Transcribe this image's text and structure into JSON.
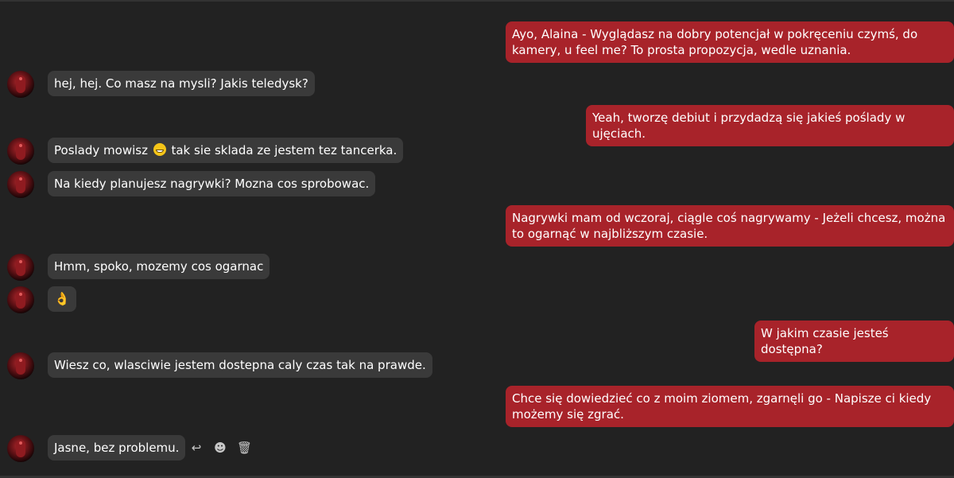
{
  "messages": {
    "m1": "Ayo, Alaina - Wyglądasz na dobry potencjał w pokręceniu czymś, do kamery, u feel me? To prosta propozycja, wedle uznania.",
    "m2": "hej, hej. Co masz na mysli? Jakis teledysk?",
    "m3": "Yeah, tworzę debiut i przydadzą się jakieś poślady w ujęciach.",
    "m4a": "Poslady mowisz ",
    "m4b": " tak sie sklada ze jestem tez tancerka.",
    "m5": "Na kiedy planujesz nagrywki? Mozna cos sprobowac.",
    "m6": "Nagrywki mam od wczoraj, ciągle coś nagrywamy - Jeżeli chcesz, można to ogarnąć w najbliższym czasie.",
    "m7": "Hmm, spoko, mozemy cos ogarnac",
    "m8": "👌",
    "m9": "W jakim czasie jesteś dostępna?",
    "m10": "Wiesz co, wlasciwie jestem dostepna caly czas tak na prawde.",
    "m11": "Chce się dowiedzieć co z moim ziomem, zgarnęli go - Napisze ci kiedy możemy się zgrać.",
    "m12": "Jasne, bez problemu."
  },
  "icons": {
    "reply": "reply-icon",
    "react": "emoji-icon",
    "delete": "trash-icon"
  },
  "colors": {
    "background": "#222222",
    "incoming": "#3a3a3a",
    "outgoing": "#a8232a"
  }
}
